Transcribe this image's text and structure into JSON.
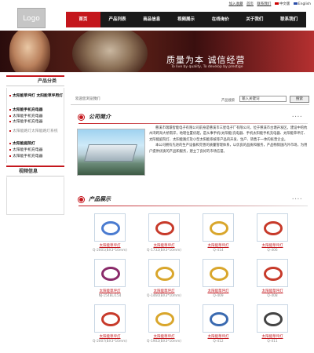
{
  "logo": "Logo",
  "toplinks": {
    "add_fav": "加入收藏",
    "home": "首页",
    "contact": "联系我们",
    "lang_cn": "中文版",
    "lang_en": "English"
  },
  "nav": [
    {
      "label": "首页",
      "active": true
    },
    {
      "label": "产品列表",
      "active": false
    },
    {
      "label": "商品信息",
      "active": false
    },
    {
      "label": "视频展示",
      "active": false
    },
    {
      "label": "在线询价",
      "active": false
    },
    {
      "label": "关于我们",
      "active": false
    },
    {
      "label": "联系我们",
      "active": false
    }
  ],
  "banner": {
    "title": "质量为本 诚信经营",
    "subtitle": "To live by quality, To develop by prestige"
  },
  "sidebar": {
    "category_title": "产品分类",
    "categories": [
      {
        "label": "太阳能草坪灯 太阳能草坪用灯",
        "style": "b"
      },
      {
        "label": "太阳能手机充电器",
        "style": "b"
      },
      {
        "label": "太阳能手机充电器",
        "style": "n"
      },
      {
        "label": "太阳能手机充电器",
        "style": "n"
      },
      {
        "label": "太阳能路灯太阳能路灯系统",
        "style": "g"
      },
      {
        "label": "太阳能庭院灯",
        "style": "b"
      },
      {
        "label": "太阳能手机充电器",
        "style": "n"
      },
      {
        "label": "太阳能手机充电器",
        "style": "n"
      }
    ],
    "video_title": "视频信息"
  },
  "search": {
    "welcome": "欢迎您浏览我们",
    "label": "产品搜索",
    "placeholder": "输入关键词",
    "button": "搜索"
  },
  "company": {
    "title": "公司简介",
    "paragraphs": [
      "慈溪市瑞璟智能电子有限公司前身是慈溪市三星电子厂有限公司，位于慈溪市古塘开发区，建设中的杭州湾跨海大桥南岸，地理位置优越，是从事手机(太阳能)充电器、手机太阳能手机充电器、太阳能草坪灯、太阳能庭院灯、太阳能路灯及小型太阳能系统等产品的开发、生产、销售于一体的民营企业。",
      "本公司拥有先进的生产设备和完善的质量管理体系，以优良的品质和服务，产品畅销国内外市场，为用户提供优质的产品和服务，建立了良好的市场信誉。"
    ]
  },
  "products": {
    "title": "产品展示",
    "items": [
      {
        "name": "太阳能草坪灯",
        "model": "Q-2001(BX3*10mm)",
        "color": "#4a7bd0"
      },
      {
        "name": "太阳能草坪灯",
        "model": "Q-1732(BX3*10mm)",
        "color": "#c73a2a"
      },
      {
        "name": "太阳能草坪灯",
        "model": "Q-414",
        "color": "#d9a62c"
      },
      {
        "name": "太阳能草坪灯",
        "model": "Q-406",
        "color": "#c73a2a"
      },
      {
        "name": "太阳能草坪灯",
        "model": "NJ-1548L/154",
        "color": "#8a2a6a"
      },
      {
        "name": "太阳能草坪灯",
        "model": "Q-1460(BX3*10mm)",
        "color": "#d9a62c"
      },
      {
        "name": "太阳能草坪灯",
        "model": "Q-409",
        "color": "#d9a62c"
      },
      {
        "name": "太阳能草坪灯",
        "model": "Q-408",
        "color": "#c73a2a"
      },
      {
        "name": "太阳能草坪灯",
        "model": "Q-2007(BX3*10mm)",
        "color": "#c73a2a"
      },
      {
        "name": "太阳能草坪灯",
        "model": "Q-1902(BX3*10mm)",
        "color": "#d9a62c"
      },
      {
        "name": "太阳能草坪灯",
        "model": "Q-412",
        "color": "#3a6ab0"
      },
      {
        "name": "太阳能草坪灯",
        "model": "Q-411",
        "color": "#444444"
      }
    ]
  }
}
